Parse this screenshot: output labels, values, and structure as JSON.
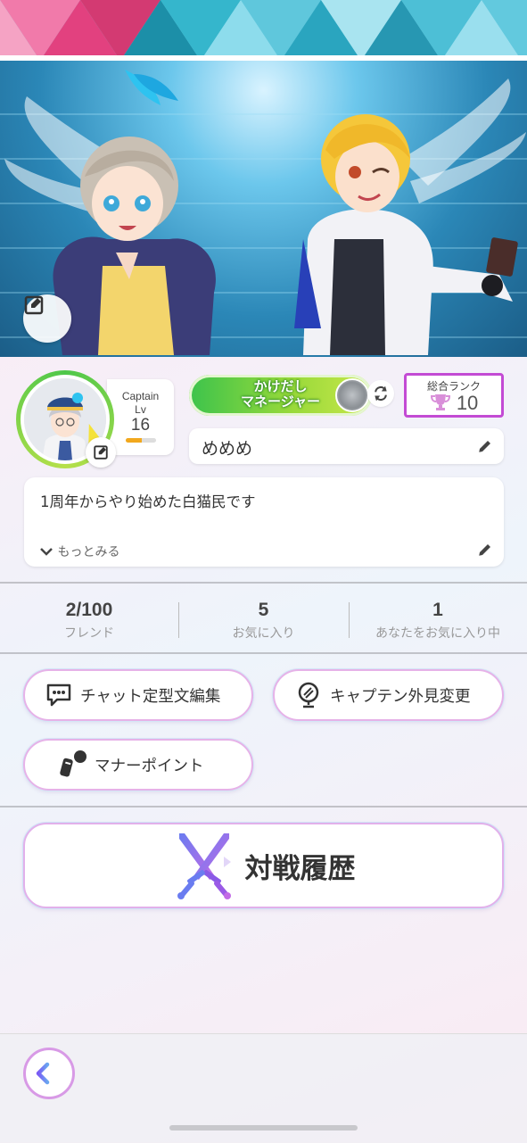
{
  "profile": {
    "captain_label": "Captain",
    "lv_label": "Lv",
    "level": "16",
    "level_progress": 0.55,
    "title_line1": "かけだし",
    "title_line2": "マネージャー",
    "rank_label": "総合ランク",
    "rank_value": "10",
    "name": "めめめ",
    "bio": "1周年からやり始めた白猫民です",
    "more_label": "もっとみる"
  },
  "stats": [
    {
      "value": "2/100",
      "label": "フレンド"
    },
    {
      "value": "5",
      "label": "お気に入り"
    },
    {
      "value": "1",
      "label": "あなたをお気に入り中"
    }
  ],
  "buttons": {
    "chat_templates": "チャット定型文編集",
    "captain_appearance": "キャプテン外見変更",
    "manner_points": "マナーポイント",
    "battle_history": "対戦履歴"
  },
  "colors": {
    "title_green": "#3cc34c",
    "rank_border": "#c34bd4",
    "accent_purple": "#7a5af5"
  },
  "icons": {
    "banner_edit": "edit-icon",
    "avatar_edit": "edit-icon",
    "refresh": "refresh-icon",
    "trophy": "trophy-icon",
    "name_edit": "pencil-icon",
    "bio_edit": "pencil-icon",
    "more": "chevron-down-icon",
    "chat": "chat-bubble-icon",
    "mirror": "mirror-icon",
    "manner": "manner-icon",
    "battle": "crossed-swords-icon",
    "back": "arrow-left-icon"
  }
}
